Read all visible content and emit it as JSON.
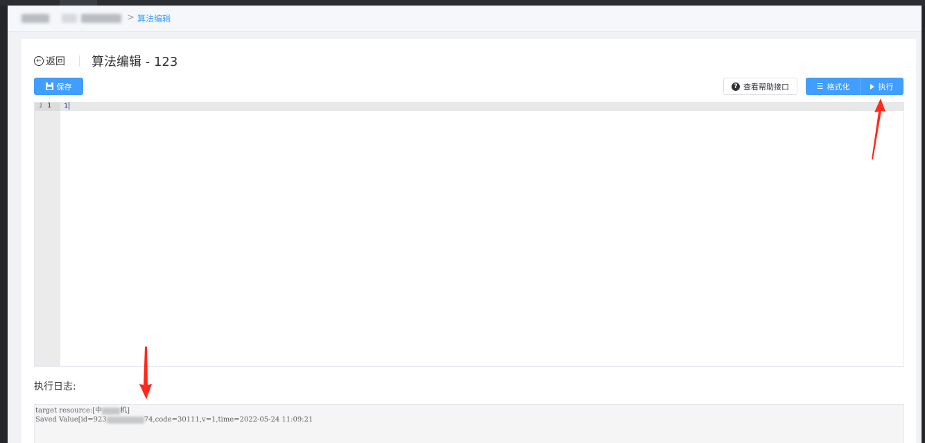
{
  "breadcrumb": {
    "separator": ">",
    "current": "算法编辑"
  },
  "header": {
    "back_label": "返回",
    "back_icon": "circle-arrow-left-icon",
    "title": "算法编辑 - 123"
  },
  "toolbar": {
    "save_label": "保存",
    "help_label": "查看帮助接口",
    "format_label": "格式化",
    "run_label": "执行"
  },
  "editor": {
    "line_number": "1",
    "line_info": "i",
    "code": "1"
  },
  "log": {
    "title": "执行日志:",
    "line1_prefix": "target resource:[中",
    "line1_suffix": "机]",
    "line2_prefix": "Saved Value[id=923",
    "line2_suffix": "74,code=30111,v=1,time=2022-05-24 11:09:21"
  },
  "colors": {
    "primary": "#409eff",
    "annotation_arrow": "#ff2a1a"
  }
}
